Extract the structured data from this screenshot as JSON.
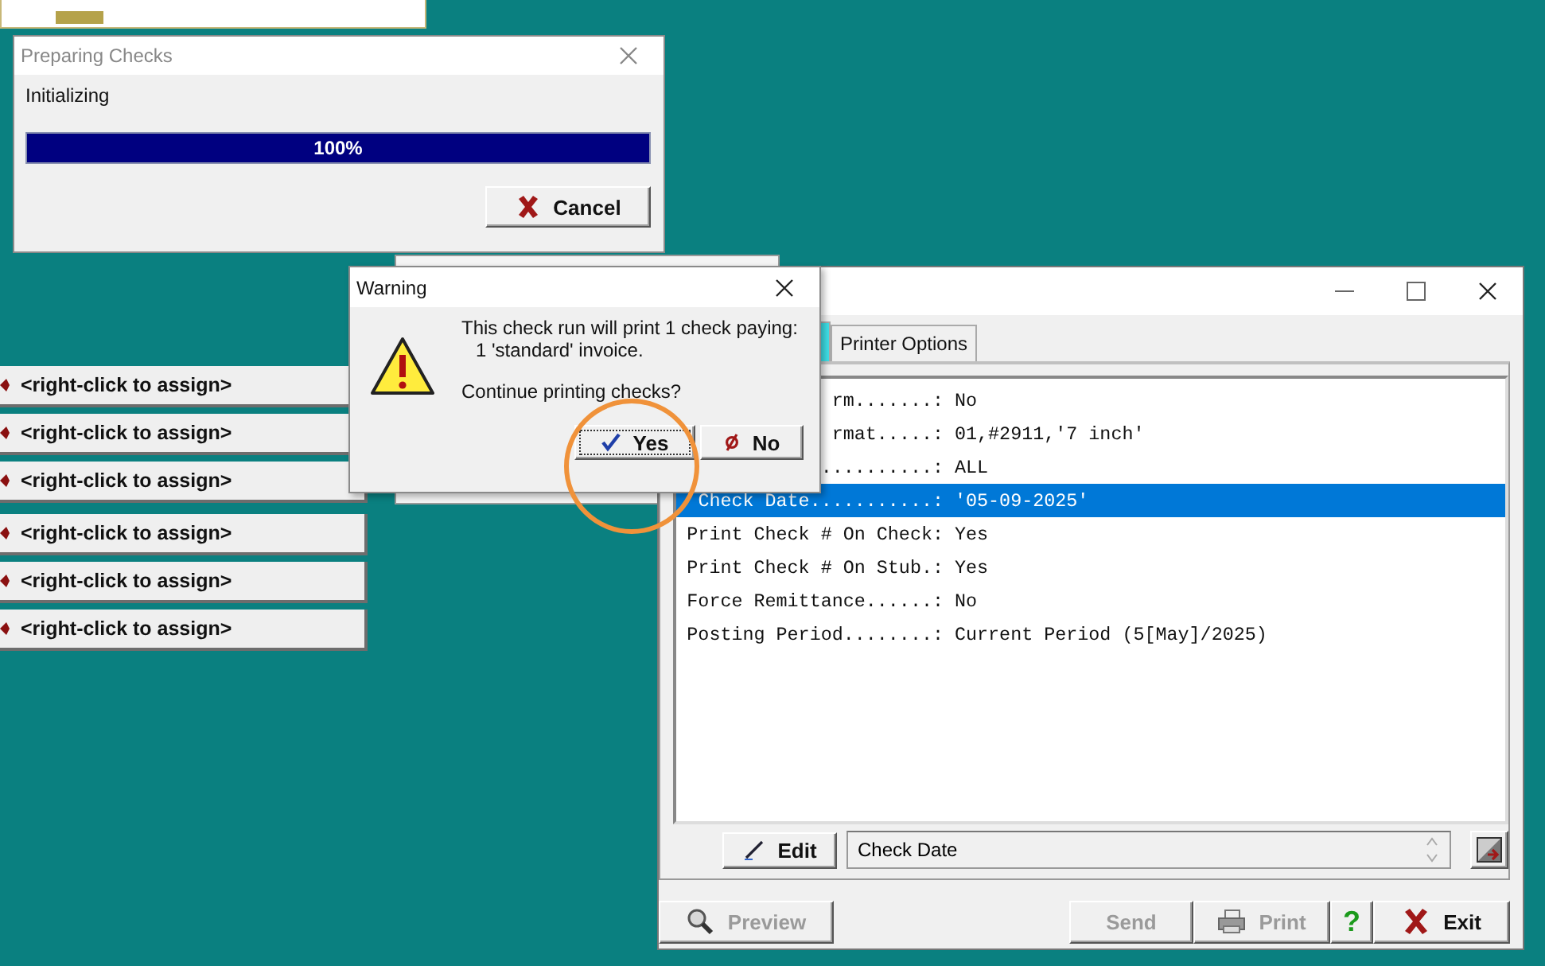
{
  "progress_window": {
    "title": "Preparing Checks",
    "status": "Initializing",
    "progress": {
      "level": 1,
      "reading": "100%"
    },
    "button": {
      "label": "Cancel"
    }
  },
  "assign_groups": [
    [
      {
        "label": "<right-click to assign>"
      },
      {
        "label": "<right-click to assign>"
      },
      {
        "label": "<right-click to assign>"
      }
    ],
    [
      {
        "label": "<right-click to assign>"
      },
      {
        "label": "<right-click to assign>"
      },
      {
        "label": "<right-click to assign>"
      }
    ]
  ],
  "main_window": {
    "tabs": [
      {
        "selected": true
      },
      {
        "label": "Printer Options",
        "selected": false
      }
    ],
    "settings": [
      {
        "label": "rm.......:",
        "value": "No",
        "selected": false
      },
      {
        "label": "rmat.....:",
        "value": "01,#2911,'7 inch'",
        "selected": false
      },
      {
        "label": "..........:",
        "value": "ALL",
        "selected": false
      },
      {
        "label": "Check Date...........:",
        "value": "'05-09-2025'",
        "selected": true
      },
      {
        "label": "Print Check # On Check:",
        "value": "Yes",
        "selected": false
      },
      {
        "label": "Print Check # On Stub.:",
        "value": "Yes",
        "selected": false
      },
      {
        "label": "Force Remittance......:",
        "value": "No",
        "selected": false
      },
      {
        "label": "Posting Period........:",
        "value": "Current Period (5[May]/2025)",
        "selected": false
      }
    ],
    "edit_button": "Edit",
    "field": {
      "value": "Check Date"
    },
    "toolbar": [
      {
        "kind": "preview",
        "label": "Preview",
        "disabled": true
      },
      {
        "kind": "spacer"
      },
      {
        "kind": "send",
        "label": "Send",
        "disabled": true
      },
      {
        "kind": "print",
        "label": "Print",
        "disabled": true
      },
      {
        "kind": "help",
        "label": "?",
        "disabled": false
      },
      {
        "kind": "exit",
        "label": "Exit",
        "disabled": false
      }
    ]
  },
  "warning_dialog": {
    "title": "Warning",
    "message": [
      "This check run will print 1 check paying:",
      "1 'standard' invoice."
    ],
    "question": "Continue printing checks?",
    "buttons": [
      {
        "label": "Yes",
        "focused": true
      },
      {
        "label": "No",
        "focused": false
      }
    ]
  },
  "annotation": {
    "kind": "circle"
  }
}
